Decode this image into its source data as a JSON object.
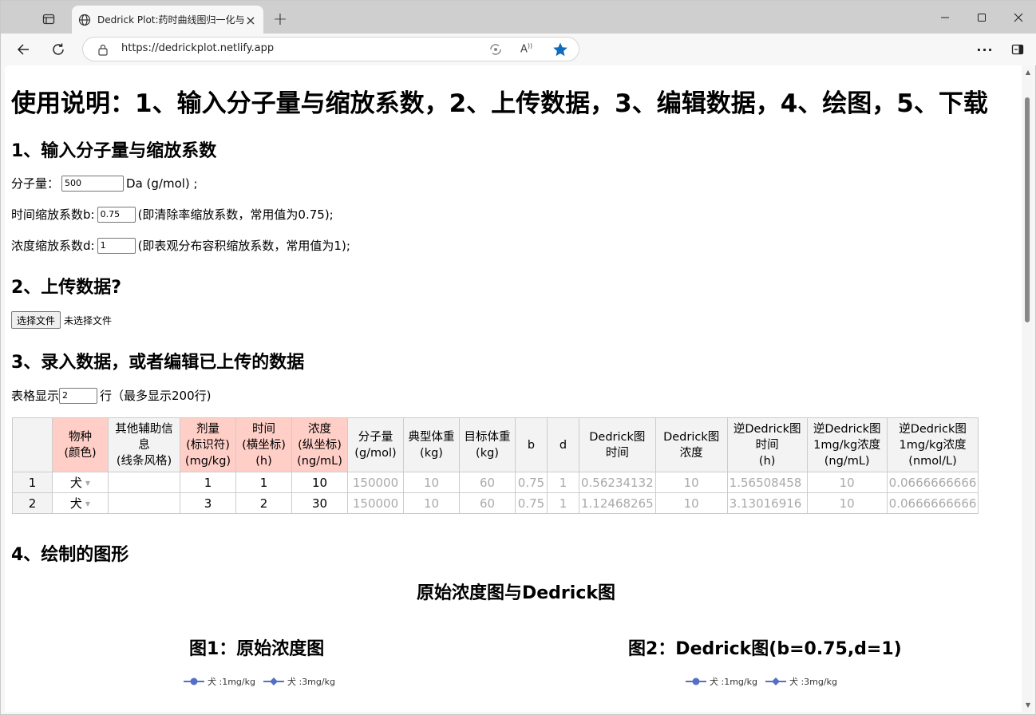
{
  "browser": {
    "tab_title": "Dedrick Plot:药时曲线图归一化与",
    "url": "https://dedrickplot.netlify.app"
  },
  "page": {
    "title": "使用说明：1、输入分子量与缩放系数，2、上传数据，3、编辑数据，4、绘图，5、下载",
    "section1": {
      "heading": "1、输入分子量与缩放系数",
      "mw_label": "分子量：",
      "mw_value": "500",
      "mw_unit": "Da (g/mol) ;",
      "b_label": "时间缩放系数b:",
      "b_value": "0.75",
      "b_note": "(即清除率缩放系数，常用值为0.75);",
      "d_label": "浓度缩放系数d:",
      "d_value": "1",
      "d_note": "(即表观分布容积缩放系数，常用值为1);"
    },
    "section2": {
      "heading": "2、上传数据?",
      "file_button": "选择文件",
      "file_status": "未选择文件"
    },
    "section3": {
      "heading": "3、录入数据，或者编辑已上传的数据",
      "rows_label": "表格显示",
      "rows_value": "2",
      "rows_note": "行（最多显示200行)"
    },
    "table": {
      "headers": [
        "物种\n(颜色)",
        "其他辅助信息\n(线条风格)",
        "剂量\n(标识符)\n(mg/kg)",
        "时间\n(横坐标)\n(h)",
        "浓度\n(纵坐标)\n(ng/mL)",
        "分子量\n(g/mol)",
        "典型体重\n(kg)",
        "目标体重\n(kg)",
        "b",
        "d",
        "Dedrick图\n时间",
        "Dedrick图\n浓度",
        "逆Dedrick图\n时间\n(h)",
        "逆Dedrick图\n1mg/kg浓度\n(ng/mL)",
        "逆Dedrick图\n1mg/kg浓度\n(nmol/L)"
      ],
      "rows": [
        {
          "n": "1",
          "cells": [
            "犬",
            "",
            "1",
            "1",
            "10",
            "150000",
            "10",
            "60",
            "0.75",
            "1",
            "0.56234132",
            "10",
            "1.56508458",
            "10",
            "0.0666666666"
          ]
        },
        {
          "n": "2",
          "cells": [
            "犬",
            "",
            "3",
            "2",
            "30",
            "150000",
            "10",
            "60",
            "0.75",
            "1",
            "1.12468265",
            "10",
            "3.13016916",
            "10",
            "0.0666666666"
          ]
        }
      ]
    },
    "section4": {
      "heading": "4、绘制的图形",
      "super_title": "原始浓度图与Dedrick图",
      "chart1_title": "图1：原始浓度图",
      "chart2_title": "图2：Dedrick图(b=0.75,d=1)",
      "legend": [
        "犬 :1mg/kg",
        "犬 :3mg/kg"
      ]
    }
  },
  "colors": {
    "header_highlight": "#ffcfc7",
    "legend_series": "#5470c6",
    "star_active": "#0f6cbd"
  }
}
